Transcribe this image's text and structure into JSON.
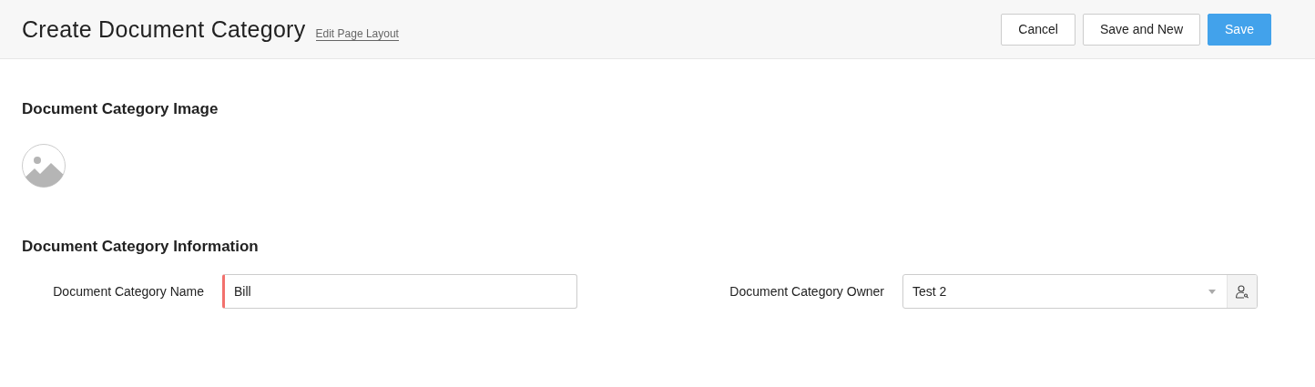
{
  "header": {
    "title": "Create Document Category",
    "link": "Edit Page Layout",
    "buttons": [
      {
        "label": "Cancel",
        "kind": "secondary"
      },
      {
        "label": "Save and New",
        "kind": "secondary"
      },
      {
        "label": "Save",
        "kind": "primary"
      }
    ]
  },
  "sections": [
    {
      "title": "Document Category Image",
      "kind": "image"
    },
    {
      "title": "Document Category Information",
      "kind": "fields",
      "fields": [
        {
          "label": "Document Category Name",
          "value": "Bill",
          "kind": "text",
          "required": true
        },
        {
          "label": "Document Category Owner",
          "value": "Test 2",
          "kind": "lookup",
          "required": false
        }
      ]
    }
  ]
}
